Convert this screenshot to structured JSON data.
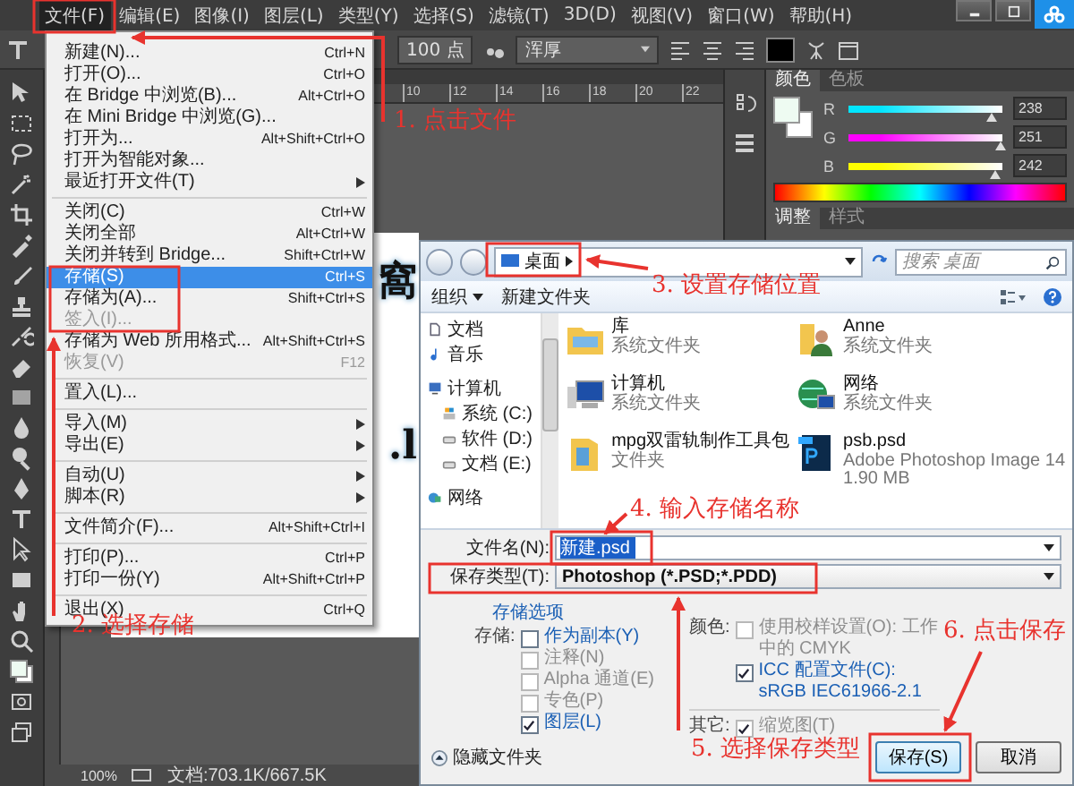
{
  "menubar": {
    "items": [
      {
        "label": "文件(F)",
        "selected": true
      },
      {
        "label": "编辑(E)",
        "selected": false
      },
      {
        "label": "图像(I)",
        "selected": false
      },
      {
        "label": "图层(L)",
        "selected": false
      },
      {
        "label": "类型(Y)",
        "selected": false
      },
      {
        "label": "选择(S)",
        "selected": false
      },
      {
        "label": "滤镜(T)",
        "selected": false
      },
      {
        "label": "3D(D)",
        "selected": false
      },
      {
        "label": "视图(V)",
        "selected": false
      },
      {
        "label": "窗口(W)",
        "selected": false
      },
      {
        "label": "帮助(H)",
        "selected": false
      }
    ]
  },
  "options_bar": {
    "font_size": "100 点",
    "antialias": "浑厚"
  },
  "ruler": {
    "ticks": [
      "10",
      "12",
      "14",
      "16",
      "18",
      "20",
      "22"
    ]
  },
  "document": {
    "artwork_text": [
      "窩",
      ".l"
    ]
  },
  "color_panel": {
    "tabs": [
      {
        "label": "颜色",
        "selected": true
      },
      {
        "label": "色板",
        "selected": false
      }
    ],
    "channels": [
      {
        "name": "R",
        "value": "238",
        "level": 0.933,
        "color": "#00e5ff"
      },
      {
        "name": "G",
        "value": "251",
        "level": 0.984,
        "color": "#ff00ff"
      },
      {
        "name": "B",
        "value": "242",
        "level": 0.949,
        "color": "#ffff00"
      }
    ]
  },
  "adjust_panel": {
    "tabs": [
      {
        "label": "调整",
        "selected": true
      },
      {
        "label": "样式",
        "selected": false
      }
    ]
  },
  "status_bar": {
    "zoom": "100%",
    "document": "文档:703.1K/667.5K"
  },
  "file_menu": {
    "groups": [
      [
        {
          "label": "新建(N)...",
          "shortcut": "Ctrl+N",
          "disabled": false,
          "selected": false,
          "submenu": false
        },
        {
          "label": "打开(O)...",
          "shortcut": "Ctrl+O",
          "disabled": false,
          "selected": false,
          "submenu": false
        },
        {
          "label": "在 Bridge 中浏览(B)...",
          "shortcut": "Alt+Ctrl+O",
          "disabled": false,
          "selected": false,
          "submenu": false
        },
        {
          "label": "在 Mini Bridge 中浏览(G)...",
          "disabled": false,
          "selected": false,
          "submenu": false
        },
        {
          "label": "打开为...",
          "shortcut": "Alt+Shift+Ctrl+O",
          "disabled": false,
          "selected": false,
          "submenu": false
        },
        {
          "label": "打开为智能对象...",
          "disabled": false,
          "selected": false,
          "submenu": false
        },
        {
          "label": "最近打开文件(T)",
          "disabled": false,
          "selected": false,
          "submenu": true
        }
      ],
      [
        {
          "label": "关闭(C)",
          "shortcut": "Ctrl+W",
          "disabled": false,
          "selected": false,
          "submenu": false
        },
        {
          "label": "关闭全部",
          "shortcut": "Alt+Ctrl+W",
          "disabled": false,
          "selected": false,
          "submenu": false
        },
        {
          "label": "关闭并转到 Bridge...",
          "shortcut": "Shift+Ctrl+W",
          "disabled": false,
          "selected": false,
          "submenu": false
        },
        {
          "label": "存储(S)",
          "shortcut": "Ctrl+S",
          "disabled": false,
          "selected": true,
          "submenu": false
        },
        {
          "label": "存储为(A)...",
          "shortcut": "Shift+Ctrl+S",
          "disabled": false,
          "selected": false,
          "submenu": false
        },
        {
          "label": "签入(I)...",
          "disabled": true,
          "selected": false,
          "submenu": false
        },
        {
          "label": "存储为 Web 所用格式...",
          "shortcut": "Alt+Shift+Ctrl+S",
          "disabled": false,
          "selected": false,
          "submenu": false
        },
        {
          "label": "恢复(V)",
          "shortcut": "F12",
          "disabled": true,
          "selected": false,
          "submenu": false
        }
      ],
      [
        {
          "label": "置入(L)...",
          "disabled": false,
          "selected": false,
          "submenu": false
        }
      ],
      [
        {
          "label": "导入(M)",
          "disabled": false,
          "selected": false,
          "submenu": true
        },
        {
          "label": "导出(E)",
          "disabled": false,
          "selected": false,
          "submenu": true
        }
      ],
      [
        {
          "label": "自动(U)",
          "disabled": false,
          "selected": false,
          "submenu": true
        },
        {
          "label": "脚本(R)",
          "disabled": false,
          "selected": false,
          "submenu": true
        }
      ],
      [
        {
          "label": "文件简介(F)...",
          "shortcut": "Alt+Shift+Ctrl+I",
          "disabled": false,
          "selected": false,
          "submenu": false
        }
      ],
      [
        {
          "label": "打印(P)...",
          "shortcut": "Ctrl+P",
          "disabled": false,
          "selected": false,
          "submenu": false
        },
        {
          "label": "打印一份(Y)",
          "shortcut": "Alt+Shift+Ctrl+P",
          "disabled": false,
          "selected": false,
          "submenu": false
        }
      ],
      [
        {
          "label": "退出(X)",
          "shortcut": "Ctrl+Q",
          "disabled": false,
          "selected": false,
          "submenu": false
        }
      ]
    ]
  },
  "dialog": {
    "location": "桌面",
    "search": {
      "placeholder": "搜索 桌面"
    },
    "toolbar": {
      "organize": "组织",
      "new_folder": "新建文件夹"
    },
    "sidebar": [
      {
        "label": "文档",
        "kind": "document"
      },
      {
        "label": "音乐",
        "kind": "music"
      },
      {
        "label": "计算机",
        "kind": "computer",
        "children": [
          {
            "label": "系统 (C:)",
            "kind": "system-drive"
          },
          {
            "label": "软件 (D:)",
            "kind": "drive"
          },
          {
            "label": "文档 (E:)",
            "kind": "drive"
          }
        ]
      },
      {
        "label": "网络",
        "kind": "network"
      }
    ],
    "files": [
      {
        "name": "库",
        "kind": "library",
        "details": [
          "系统文件夹"
        ]
      },
      {
        "name": "Anne",
        "kind": "user",
        "details": [
          "系统文件夹"
        ]
      },
      {
        "name": "计算机",
        "kind": "computer",
        "details": [
          "系统文件夹"
        ]
      },
      {
        "name": "网络",
        "kind": "network",
        "details": [
          "系统文件夹"
        ]
      },
      {
        "name": "mpg双雷轨制作工具包",
        "kind": "folder",
        "details": [
          "文件夹"
        ]
      },
      {
        "name": "psb.psd",
        "kind": "psd",
        "details": [
          "Adobe Photoshop Image 14",
          "1.90 MB"
        ]
      }
    ],
    "file_name": {
      "label": "文件名(N):",
      "value": "新建.psd"
    },
    "file_type": {
      "label": "保存类型(T):",
      "value": "Photoshop (*.PSD;*.PDD)"
    },
    "options_link": "存储选项",
    "save_options": {
      "label": "存储:",
      "items": [
        {
          "label": "作为副本(Y)",
          "checked": false,
          "disabled": false
        },
        {
          "label": "注释(N)",
          "checked": false,
          "disabled": true
        },
        {
          "label": "Alpha 通道(E)",
          "checked": false,
          "disabled": true
        },
        {
          "label": "专色(P)",
          "checked": false,
          "disabled": true
        },
        {
          "label": "图层(L)",
          "checked": true,
          "disabled": false
        }
      ]
    },
    "color_options": {
      "label": "颜色:",
      "items": [
        {
          "label": "使用校样设置(O): 工作中的 CMYK",
          "checked": false,
          "disabled": true
        },
        {
          "label": "ICC 配置文件(C): sRGB IEC61966-2.1",
          "checked": true,
          "disabled": false
        }
      ]
    },
    "other_options": {
      "label": "其它:",
      "items": [
        {
          "label": "缩览图(T)",
          "checked": true,
          "disabled": true
        }
      ]
    },
    "hide_folders": "隐藏文件夹",
    "buttons": [
      {
        "label": "保存(S)",
        "primary": true
      },
      {
        "label": "取消",
        "primary": false
      }
    ]
  },
  "annotations": [
    "1. 点击文件",
    "2. 选择存储",
    "3. 设置存储位置",
    "4. 输入存储名称",
    "5. 选择保存类型",
    "6. 点击保存"
  ]
}
